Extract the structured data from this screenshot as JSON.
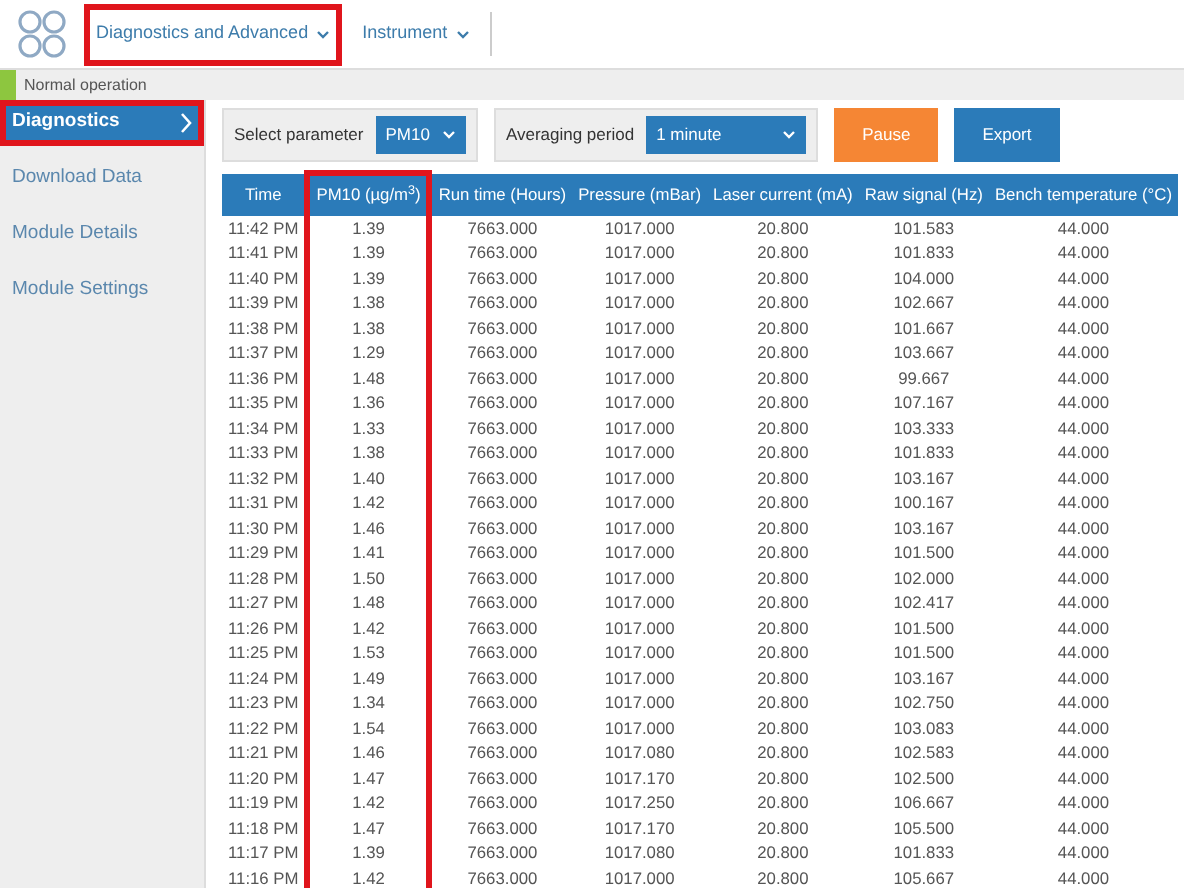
{
  "topnav": [
    {
      "label": "Diagnostics and Advanced",
      "highlighted": true
    },
    {
      "label": "Instrument",
      "highlighted": false
    }
  ],
  "status": {
    "text": "Normal operation"
  },
  "sidebar": {
    "items": [
      {
        "label": "Diagnostics",
        "selected": true,
        "highlighted": true
      },
      {
        "label": "Download Data",
        "selected": false,
        "highlighted": false
      },
      {
        "label": "Module Details",
        "selected": false,
        "highlighted": false
      },
      {
        "label": "Module Settings",
        "selected": false,
        "highlighted": false
      }
    ]
  },
  "controls": {
    "parameter": {
      "label": "Select parameter",
      "value": "PM10"
    },
    "averaging": {
      "label": "Averaging period",
      "value": "1 minute"
    },
    "buttons": [
      {
        "label": "Pause",
        "kind": "warning"
      },
      {
        "label": "Export",
        "kind": "primary"
      }
    ]
  },
  "table": {
    "columns": [
      {
        "label": "Time",
        "highlighted": false
      },
      {
        "label": "PM10 (µg/m$^{3}$)",
        "highlighted": true
      },
      {
        "label": "Run time (Hours)",
        "highlighted": false
      },
      {
        "label": "Pressure (mBar)",
        "highlighted": false
      },
      {
        "label": "Laser current (mA)",
        "highlighted": false
      },
      {
        "label": "Raw signal (Hz)",
        "highlighted": false
      },
      {
        "label": "Bench temperature (°C)",
        "highlighted": false
      }
    ],
    "rows": [
      [
        "11:42 PM",
        "1.39",
        "7663.000",
        "1017.000",
        "20.800",
        "101.583",
        "44.000"
      ],
      [
        "11:41 PM",
        "1.39",
        "7663.000",
        "1017.000",
        "20.800",
        "101.833",
        "44.000"
      ],
      [
        "11:40 PM",
        "1.39",
        "7663.000",
        "1017.000",
        "20.800",
        "104.000",
        "44.000"
      ],
      [
        "11:39 PM",
        "1.38",
        "7663.000",
        "1017.000",
        "20.800",
        "102.667",
        "44.000"
      ],
      [
        "11:38 PM",
        "1.38",
        "7663.000",
        "1017.000",
        "20.800",
        "101.667",
        "44.000"
      ],
      [
        "11:37 PM",
        "1.29",
        "7663.000",
        "1017.000",
        "20.800",
        "103.667",
        "44.000"
      ],
      [
        "11:36 PM",
        "1.48",
        "7663.000",
        "1017.000",
        "20.800",
        "99.667",
        "44.000"
      ],
      [
        "11:35 PM",
        "1.36",
        "7663.000",
        "1017.000",
        "20.800",
        "107.167",
        "44.000"
      ],
      [
        "11:34 PM",
        "1.33",
        "7663.000",
        "1017.000",
        "20.800",
        "103.333",
        "44.000"
      ],
      [
        "11:33 PM",
        "1.38",
        "7663.000",
        "1017.000",
        "20.800",
        "101.833",
        "44.000"
      ],
      [
        "11:32 PM",
        "1.40",
        "7663.000",
        "1017.000",
        "20.800",
        "103.167",
        "44.000"
      ],
      [
        "11:31 PM",
        "1.42",
        "7663.000",
        "1017.000",
        "20.800",
        "100.167",
        "44.000"
      ],
      [
        "11:30 PM",
        "1.46",
        "7663.000",
        "1017.000",
        "20.800",
        "103.167",
        "44.000"
      ],
      [
        "11:29 PM",
        "1.41",
        "7663.000",
        "1017.000",
        "20.800",
        "101.500",
        "44.000"
      ],
      [
        "11:28 PM",
        "1.50",
        "7663.000",
        "1017.000",
        "20.800",
        "102.000",
        "44.000"
      ],
      [
        "11:27 PM",
        "1.48",
        "7663.000",
        "1017.000",
        "20.800",
        "102.417",
        "44.000"
      ],
      [
        "11:26 PM",
        "1.42",
        "7663.000",
        "1017.000",
        "20.800",
        "101.500",
        "44.000"
      ],
      [
        "11:25 PM",
        "1.53",
        "7663.000",
        "1017.000",
        "20.800",
        "101.500",
        "44.000"
      ],
      [
        "11:24 PM",
        "1.49",
        "7663.000",
        "1017.000",
        "20.800",
        "103.167",
        "44.000"
      ],
      [
        "11:23 PM",
        "1.34",
        "7663.000",
        "1017.000",
        "20.800",
        "102.750",
        "44.000"
      ],
      [
        "11:22 PM",
        "1.54",
        "7663.000",
        "1017.000",
        "20.800",
        "103.083",
        "44.000"
      ],
      [
        "11:21 PM",
        "1.46",
        "7663.000",
        "1017.080",
        "20.800",
        "102.583",
        "44.000"
      ],
      [
        "11:20 PM",
        "1.47",
        "7663.000",
        "1017.170",
        "20.800",
        "102.500",
        "44.000"
      ],
      [
        "11:19 PM",
        "1.42",
        "7663.000",
        "1017.250",
        "20.800",
        "106.667",
        "44.000"
      ],
      [
        "11:18 PM",
        "1.47",
        "7663.000",
        "1017.170",
        "20.800",
        "105.500",
        "44.000"
      ],
      [
        "11:17 PM",
        "1.39",
        "7663.000",
        "1017.080",
        "20.800",
        "101.833",
        "44.000"
      ],
      [
        "11:16 PM",
        "1.42",
        "7663.000",
        "1017.000",
        "20.800",
        "105.667",
        "44.000"
      ]
    ]
  }
}
